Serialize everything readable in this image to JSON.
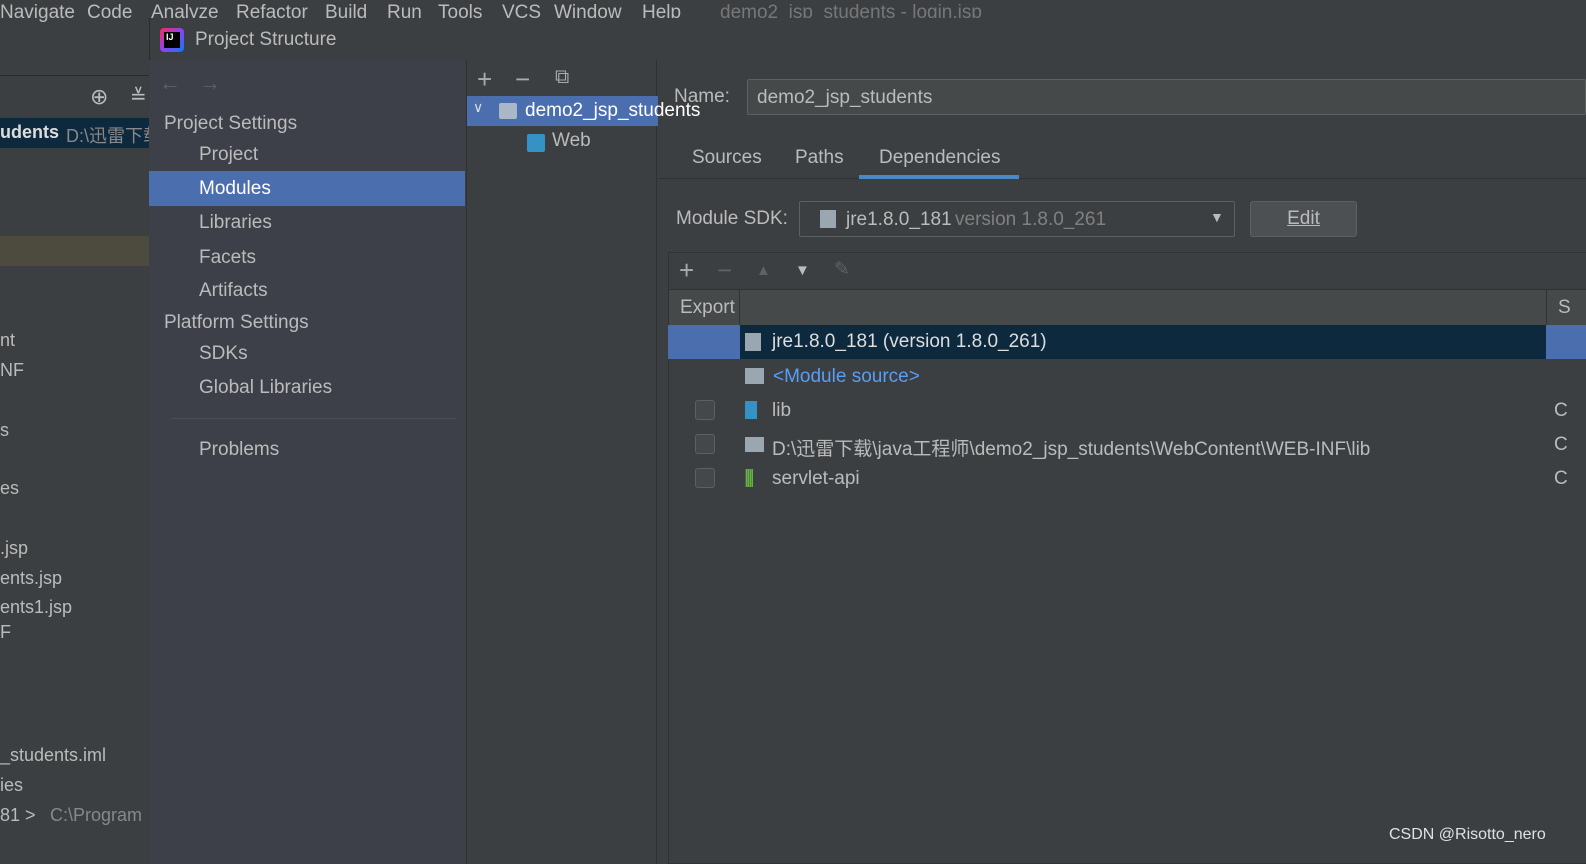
{
  "menubar": {
    "items": [
      "Navigate",
      "Code",
      "Analyze",
      "Refactor",
      "Build",
      "Run",
      "Tools",
      "VCS",
      "Window",
      "Help"
    ],
    "window_title": "demo2_jsp_students - login.jsp"
  },
  "ide_left": {
    "project_label": "udents",
    "project_path": "D:\\迅雷下载",
    "items": [
      "nt",
      "NF",
      "s",
      "es",
      ".jsp",
      "ents.jsp",
      "ents1.jsp",
      "F",
      "_students.iml",
      "ies"
    ],
    "sdk_line": "81 >",
    "sdk_path": "C:\\Program"
  },
  "dialog": {
    "title": "Project Structure"
  },
  "sidebar": {
    "project_settings": "Project Settings",
    "ps_items": [
      "Project",
      "Modules",
      "Libraries",
      "Facets",
      "Artifacts"
    ],
    "platform_settings": "Platform Settings",
    "pl_items": [
      "SDKs",
      "Global Libraries"
    ],
    "problems": "Problems",
    "selected": "Modules"
  },
  "tree": {
    "module": "demo2_jsp_students",
    "child": "Web"
  },
  "main": {
    "name_label": "Name:",
    "name_value": "demo2_jsp_students",
    "tabs": [
      "Sources",
      "Paths",
      "Dependencies"
    ],
    "active_tab": "Dependencies",
    "sdk_label": "Module SDK:",
    "sdk_value": "jre1.8.0_181",
    "sdk_version": "version 1.8.0_261",
    "edit_label": "Edit",
    "table": {
      "col_export": "Export",
      "col_scope": "S",
      "rows": [
        {
          "name": "jre1.8.0_181 (version 1.8.0_261)",
          "checkbox": false,
          "scope": "",
          "selected": true,
          "icon": "jdk-icon"
        },
        {
          "name": "<Module source>",
          "checkbox": false,
          "scope": "",
          "icon": "module-source-icon"
        },
        {
          "name": "lib",
          "checkbox": true,
          "checked": false,
          "scope": "C",
          "icon": "library-icon"
        },
        {
          "name": "D:\\迅雷下载\\java工程师\\demo2_jsp_students\\WebContent\\WEB-INF\\lib",
          "checkbox": true,
          "checked": false,
          "scope": "C",
          "icon": "folder-icon"
        },
        {
          "name": "servlet-api",
          "checkbox": true,
          "checked": false,
          "scope": "C",
          "icon": "library-bars-icon"
        }
      ]
    }
  },
  "watermark": "CSDN @Risotto_nero",
  "colors": {
    "accent": "#4b6eaf",
    "selected_row": "#0d293e",
    "link": "#589df6"
  }
}
